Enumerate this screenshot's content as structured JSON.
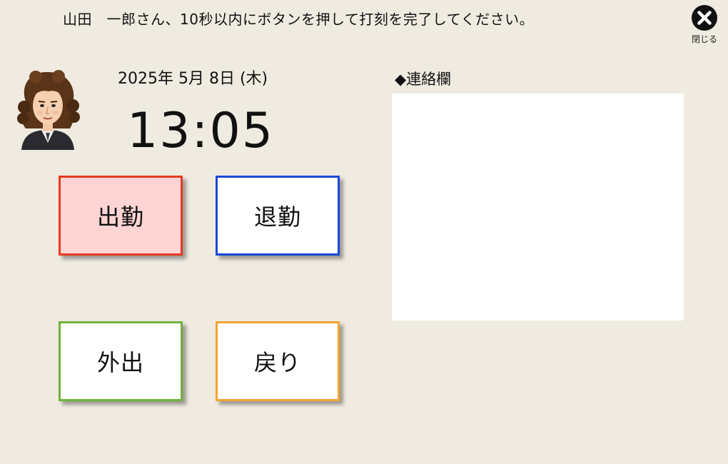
{
  "header": {
    "instruction": "山田　一郎さん、10秒以内にボタンを押して打刻を完了してください。",
    "close_label": "閉じる",
    "close_icon": "close-circle-icon"
  },
  "user": {
    "avatar": "user-avatar-illustration"
  },
  "clock": {
    "date": "2025年 5月 8日 (木)",
    "time": "13:05"
  },
  "buttons": {
    "clock_in": "出勤",
    "clock_out": "退勤",
    "go_out": "外出",
    "return": "戻り"
  },
  "notes": {
    "title": "◆連絡欄",
    "value": ""
  },
  "colors": {
    "background": "#f0ebe1",
    "clock_in_border": "#e63a22",
    "clock_in_fill": "#ffd4d4",
    "clock_out_border": "#1848d8",
    "go_out_border": "#6fb33c",
    "return_border": "#f2a431"
  }
}
